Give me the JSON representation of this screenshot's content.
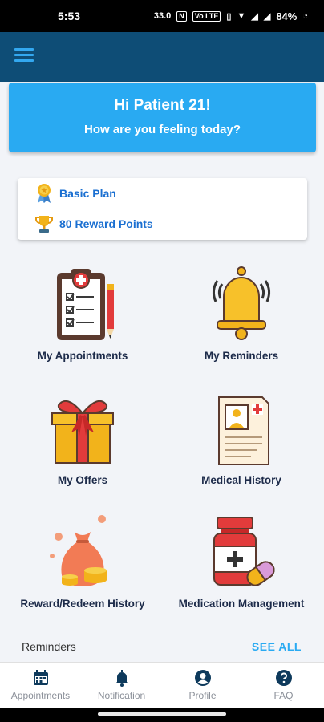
{
  "status_bar": {
    "time": "5:53",
    "speed": "33.0",
    "volte": "Vo LTE",
    "battery": "84%"
  },
  "app_bar": {
    "menu_icon": "hamburger-menu-icon"
  },
  "greeting": {
    "title": "Hi Patient 21!",
    "subtitle": "How are you feeling today?"
  },
  "plan": {
    "plan_name": "Basic Plan",
    "reward_points": "80 Reward Points",
    "plan_icon": "medal-icon",
    "reward_icon": "trophy-icon"
  },
  "grid": [
    {
      "label": "My Appointments",
      "icon": "clipboard-checklist-icon"
    },
    {
      "label": "My Reminders",
      "icon": "bell-icon"
    },
    {
      "label": "My Offers",
      "icon": "gift-box-icon"
    },
    {
      "label": "Medical History",
      "icon": "medical-record-icon"
    },
    {
      "label": "Reward/Redeem History",
      "icon": "money-bag-icon"
    },
    {
      "label": "Medication Management",
      "icon": "medicine-bottle-icon"
    }
  ],
  "reminders": {
    "title": "Reminders",
    "see_all": "SEE ALL"
  },
  "bottom_nav": [
    {
      "label": "Appointments",
      "icon": "calendar-icon"
    },
    {
      "label": "Notification",
      "icon": "bell-icon"
    },
    {
      "label": "Profile",
      "icon": "user-icon"
    },
    {
      "label": "FAQ",
      "icon": "question-icon"
    }
  ],
  "colors": {
    "app_bar": "#0e4d76",
    "accent": "#29aaf2",
    "background": "#f2f4f8",
    "label_text": "#1d2b4a",
    "nav_inactive": "#8a8f98"
  }
}
